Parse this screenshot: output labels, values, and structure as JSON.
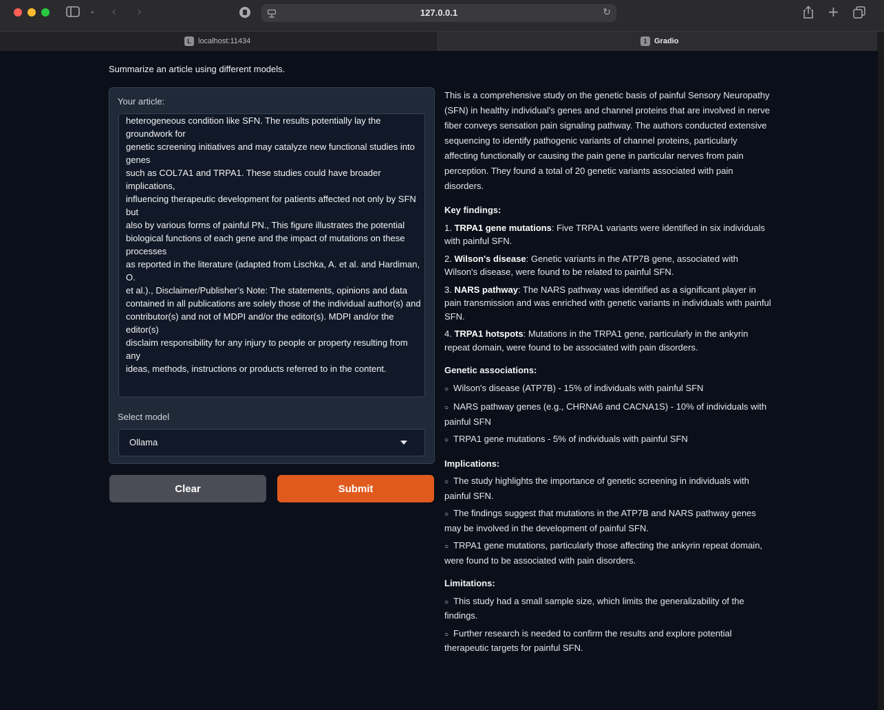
{
  "browser": {
    "url": "127.0.0.1",
    "tabs": [
      {
        "badge": "L",
        "label": "localhost:11434"
      },
      {
        "badge": "1",
        "label": "Gradio"
      }
    ]
  },
  "app": {
    "description": "Summarize an article using different models.",
    "article_label": "Your article:",
    "article_text": "heterogeneous condition like SFN. The results potentially lay the groundwork for\ngenetic screening initiatives and may catalyze new functional studies into genes\nsuch as COL7A1 and TRPA1. These studies could have broader implications,\ninfluencing therapeutic development for patients affected not only by SFN but\nalso by various forms of painful PN., This figure illustrates the potential biological functions of each gene and the impact of mutations on these processes\nas reported in the literature (adapted from Lischka, A. et al. and Hardiman, O.\net al.)., Disclaimer/Publisher’s Note: The statements, opinions and data contained in all publications are solely those of the individual author(s) and\ncontributor(s) and not of MDPI and/or the editor(s). MDPI and/or the editor(s)\ndisclaim responsibility for any injury to people or property resulting from any\nideas, methods, instructions or products referred to in the content.",
    "model_label": "Select model",
    "model_value": "Ollama",
    "clear_label": "Clear",
    "submit_label": "Submit"
  },
  "output": {
    "intro": "This is a comprehensive study on the genetic basis of painful Sensory Neuropathy (SFN) in healthy individual's genes and channel proteins that are involved in nerve fiber conveys sensation pain signaling pathway. The authors conducted extensive sequencing to identify pathogenic variants of channel proteins, particularly affecting functionally or causing the pain gene in particular nerves from pain perception. They found a total of 20 genetic variants associated with pain disorders.",
    "key_findings_heading": "Key findings:",
    "key_findings": [
      {
        "num": "1.",
        "title": "TRPA1 gene mutations",
        "text": ": Five TRPA1 variants were identified in six individuals with painful SFN."
      },
      {
        "num": "2.",
        "title": "Wilson's disease",
        "text": ": Genetic variants in the ATP7B gene, associated with Wilson's disease, were found to be related to painful SFN."
      },
      {
        "num": "3.",
        "title": "NARS pathway",
        "text": ": The NARS pathway was identified as a significant player in pain transmission and was enriched with genetic variants in individuals with painful SFN."
      },
      {
        "num": "4.",
        "title": "TRPA1 hotspots",
        "text": ": Mutations in the TRPA1 gene, particularly in the ankyrin repeat domain, were found to be associated with pain disorders."
      }
    ],
    "genetic_heading": "Genetic associations:",
    "genetic": [
      "Wilson's disease (ATP7B) - 15% of individuals with painful SFN",
      "NARS pathway genes (e.g., CHRNA6 and CACNA1S) - 10% of individuals with painful SFN",
      "TRPA1 gene mutations - 5% of individuals with painful SFN"
    ],
    "implications_heading": "Implications:",
    "implications": [
      "The study highlights the importance of genetic screening in individuals with painful SFN.",
      "The findings suggest that mutations in the ATP7B and NARS pathway genes may be involved in the development of painful SFN.",
      "TRPA1 gene mutations, particularly those affecting the ankyrin repeat domain, were found to be associated with pain disorders."
    ],
    "limitations_heading": "Limitations:",
    "limitations": [
      "This study had a small sample size, which limits the generalizability of the findings.",
      "Further research is needed to confirm the results and explore potential therapeutic targets for painful SFN."
    ]
  }
}
